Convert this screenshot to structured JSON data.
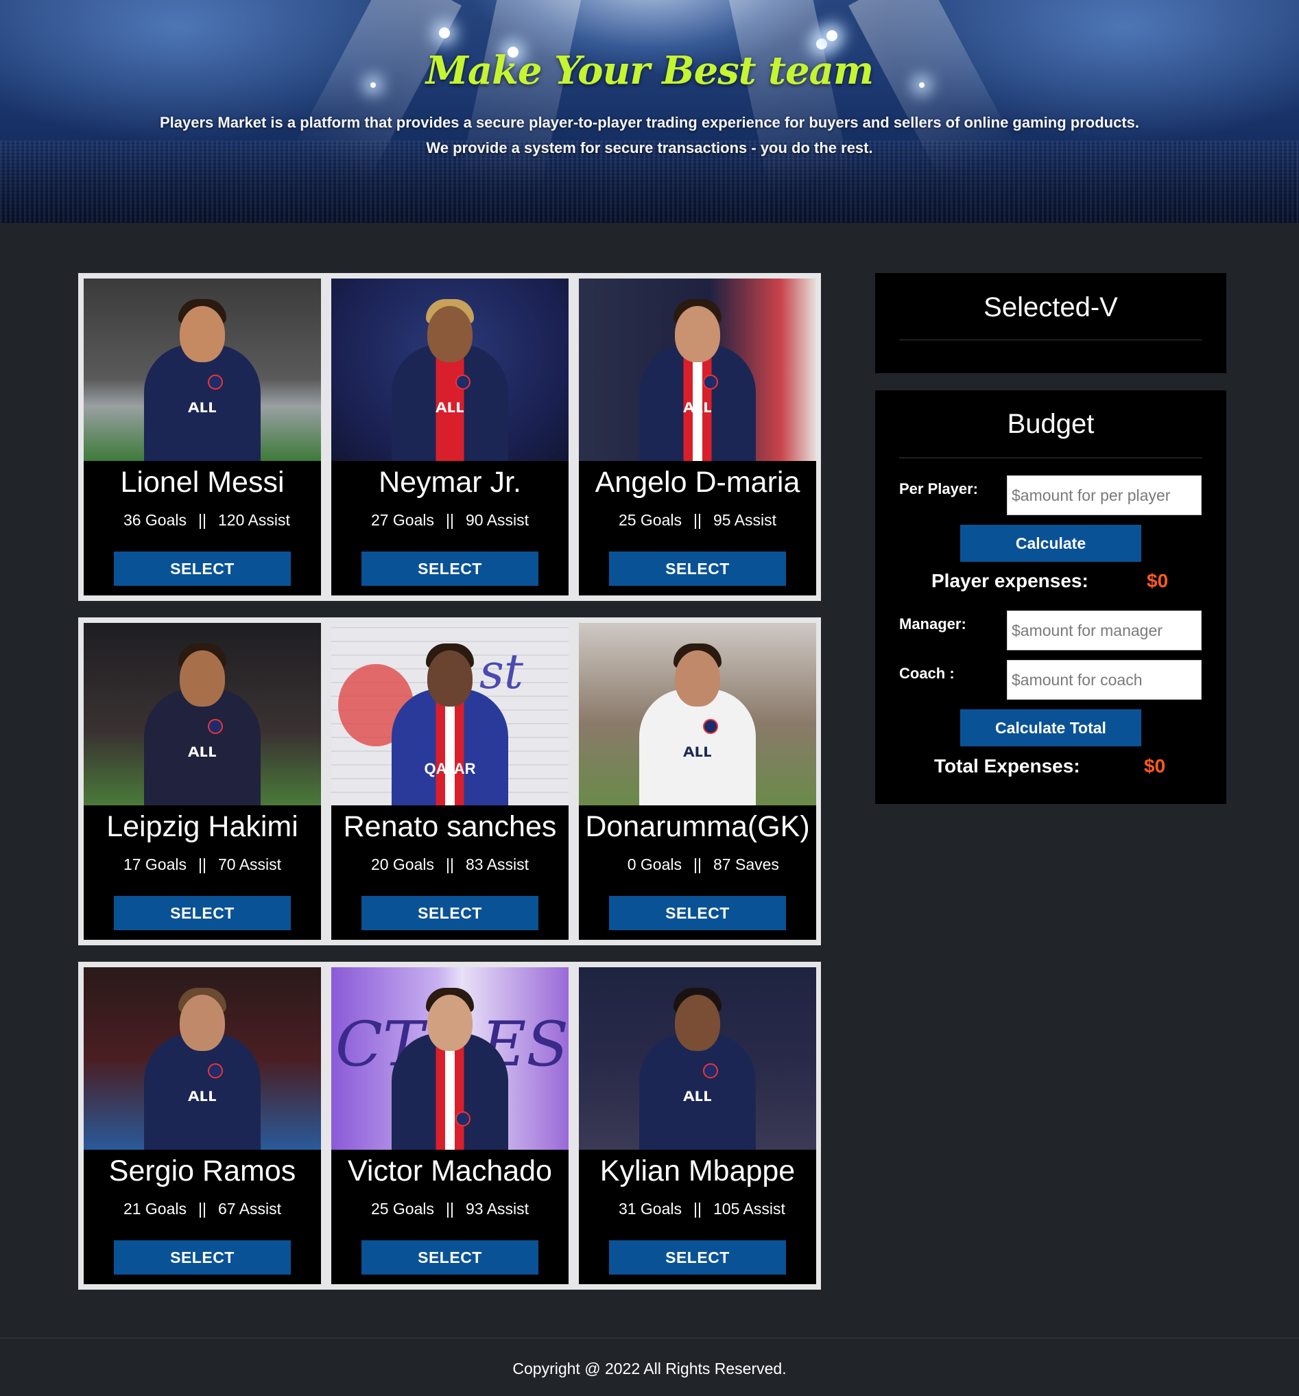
{
  "banner": {
    "title": "Make Your Best team",
    "desc_line1": "Players Market is a platform that provides a secure player-to-player trading experience for buyers and sellers of online gaming products.",
    "desc_line2": "We provide a system for secure transactions - you do the rest."
  },
  "players": [
    {
      "name": "Lionel Messi",
      "stat_a": "36 Goals",
      "sep": "||",
      "stat_b": "120 Assist",
      "button": "SELECT"
    },
    {
      "name": "Neymar Jr.",
      "stat_a": "27 Goals",
      "sep": "||",
      "stat_b": "90 Assist",
      "button": "SELECT"
    },
    {
      "name": "Angelo D-maria",
      "stat_a": "25 Goals",
      "sep": "||",
      "stat_b": "95 Assist",
      "button": "SELECT"
    },
    {
      "name": "Leipzig Hakimi",
      "stat_a": "17 Goals",
      "sep": "||",
      "stat_b": "70 Assist",
      "button": "SELECT"
    },
    {
      "name": "Renato sanches",
      "stat_a": "20 Goals",
      "sep": "||",
      "stat_b": "83 Assist",
      "button": "SELECT"
    },
    {
      "name": "Donarumma(GK)",
      "stat_a": "0 Goals",
      "sep": "||",
      "stat_b": "87 Saves",
      "button": "SELECT"
    },
    {
      "name": "Sergio Ramos",
      "stat_a": "21 Goals",
      "sep": "||",
      "stat_b": "67 Assist",
      "button": "SELECT"
    },
    {
      "name": "Victor Machado",
      "stat_a": "25 Goals",
      "sep": "||",
      "stat_b": "93 Assist",
      "button": "SELECT"
    },
    {
      "name": "Kylian Mbappe",
      "stat_a": "31 Goals",
      "sep": "||",
      "stat_b": "105 Assist",
      "button": "SELECT"
    }
  ],
  "selected": {
    "title": "Selected-V"
  },
  "budget": {
    "title": "Budget",
    "per_player_label": "Per Player:",
    "per_player_placeholder": "$amount for per player",
    "calculate_label": "Calculate",
    "player_expenses_label": "Player expenses:",
    "player_expenses_value": "$0",
    "manager_label": "Manager:",
    "manager_placeholder": "$amount for manager",
    "coach_label": "Coach :",
    "coach_placeholder": "$amount for coach",
    "calculate_total_label": "Calculate Total",
    "total_expenses_label": "Total Expenses:",
    "total_expenses_value": "$0"
  },
  "footer": {
    "text": "Copyright @ 2022 All Rights Reserved."
  },
  "colors": {
    "page_bg": "#212429",
    "title_accent": "#c5f531",
    "button_blue": "#0a5296",
    "value_orange": "#ff5a1f"
  }
}
